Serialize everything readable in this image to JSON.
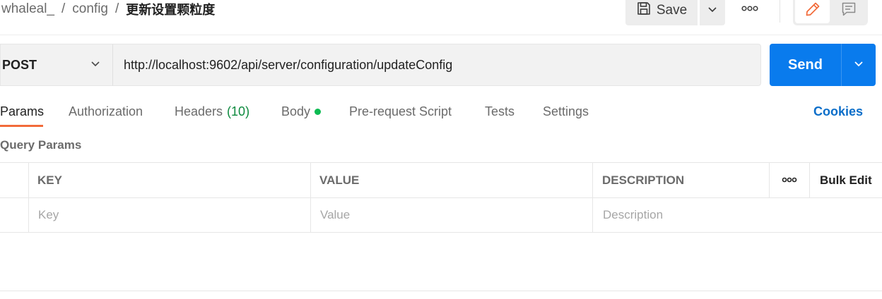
{
  "breadcrumb": {
    "workspace": "whaleal_",
    "collection": "config",
    "request": "更新设置颗粒度",
    "separator": "/"
  },
  "toolbar": {
    "save_label": "Save",
    "save_icon": "save-icon",
    "more_icon": "more-horizontal-icon",
    "modes": [
      {
        "icon": "pencil-icon",
        "active": true
      },
      {
        "icon": "comment-icon",
        "active": false
      }
    ]
  },
  "request": {
    "method": "POST",
    "url": "http://localhost:9602/api/server/configuration/updateConfig",
    "send_label": "Send"
  },
  "tabs": [
    {
      "label": "Params",
      "active": true
    },
    {
      "label": "Authorization",
      "active": false
    },
    {
      "label": "Headers",
      "count": "(10)",
      "active": false
    },
    {
      "label": "Body",
      "indicator": "green-dot",
      "active": false
    },
    {
      "label": "Pre-request Script",
      "active": false
    },
    {
      "label": "Tests",
      "active": false
    },
    {
      "label": "Settings",
      "active": false
    }
  ],
  "cookies_label": "Cookies",
  "query_params": {
    "title": "Query Params",
    "columns": [
      "KEY",
      "VALUE",
      "DESCRIPTION"
    ],
    "bulk_edit_label": "Bulk Edit",
    "placeholders": {
      "key": "Key",
      "value": "Value",
      "description": "Description"
    }
  },
  "colors": {
    "accent_send": "#097bed",
    "tab_underline": "#f26b3a",
    "headers_count": "#0d8a3e",
    "body_dot": "#0cbb52",
    "cookies_link": "#0b6ec9",
    "pencil_icon": "#f26b3a"
  }
}
